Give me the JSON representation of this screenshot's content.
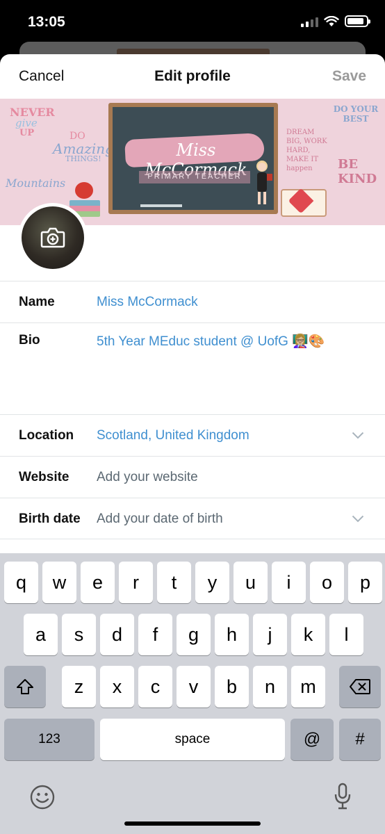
{
  "status_bar": {
    "time": "13:05",
    "battery_level": 0.9
  },
  "header": {
    "cancel": "Cancel",
    "title": "Edit profile",
    "save": "Save"
  },
  "banner": {
    "board_title": "Miss McCormack",
    "board_subtitle": "PRIMARY TEACHER",
    "deco_never": "NEVER",
    "deco_give": "give",
    "deco_up": "UP",
    "deco_do": "DO",
    "deco_amazing": "Amazing",
    "deco_things": "THINGS!",
    "deco_mountains": "Mountains",
    "deco_do_your_best": "DO YOUR BEST",
    "deco_dream": "DREAM BIG, WORK HARD, MAKE IT happen",
    "deco_be_kind": "BE KIND"
  },
  "form": {
    "name_label": "Name",
    "name_value": "Miss McCormack",
    "bio_label": "Bio",
    "bio_value": "5th Year MEduc student @ UofG 👩🏼‍🏫🎨",
    "location_label": "Location",
    "location_value": "Scotland, United Kingdom",
    "website_label": "Website",
    "website_placeholder": "Add your website",
    "birth_label": "Birth date",
    "birth_placeholder": "Add your date of birth"
  },
  "keyboard": {
    "row1": [
      "q",
      "w",
      "e",
      "r",
      "t",
      "y",
      "u",
      "i",
      "o",
      "p"
    ],
    "row2": [
      "a",
      "s",
      "d",
      "f",
      "g",
      "h",
      "j",
      "k",
      "l"
    ],
    "row3": [
      "z",
      "x",
      "c",
      "v",
      "b",
      "n",
      "m"
    ],
    "numbers": "123",
    "space": "space",
    "at": "@",
    "hash": "#"
  },
  "icons": {
    "camera": "camera-plus-icon",
    "shift": "shift-icon",
    "backspace": "backspace-icon",
    "emoji": "emoji-icon",
    "mic": "microphone-icon",
    "chevron": "chevron-down-icon"
  }
}
